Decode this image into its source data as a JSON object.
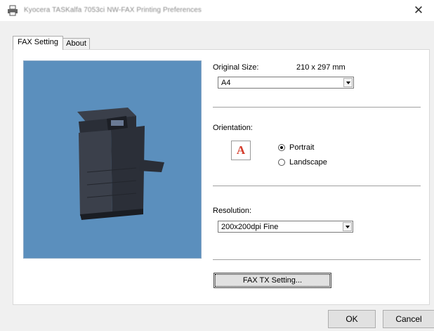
{
  "window": {
    "title": "Kyocera TASKalfa 7053ci NW-FAX Printing Preferences",
    "close_glyph": "✕"
  },
  "tabs": [
    {
      "label": "FAX Setting"
    },
    {
      "label": "About"
    }
  ],
  "original_size": {
    "label": "Original Size:",
    "dimension": "210 x 297 mm",
    "selected": "A4"
  },
  "orientation": {
    "label": "Orientation:",
    "preview_letter": "A",
    "options": [
      {
        "label": "Portrait",
        "checked": true
      },
      {
        "label": "Landscape",
        "checked": false
      }
    ]
  },
  "resolution": {
    "label": "Resolution:",
    "selected": "200x200dpi Fine"
  },
  "fax_tx_button": "FAX TX Setting...",
  "footer": {
    "ok": "OK",
    "cancel": "Cancel"
  },
  "icons": {
    "title": "printer-icon",
    "preview": "multifunction-printer-image"
  },
  "colors": {
    "preview_background": "#5b8fbd",
    "orientation_letter": "#d43b2a"
  }
}
